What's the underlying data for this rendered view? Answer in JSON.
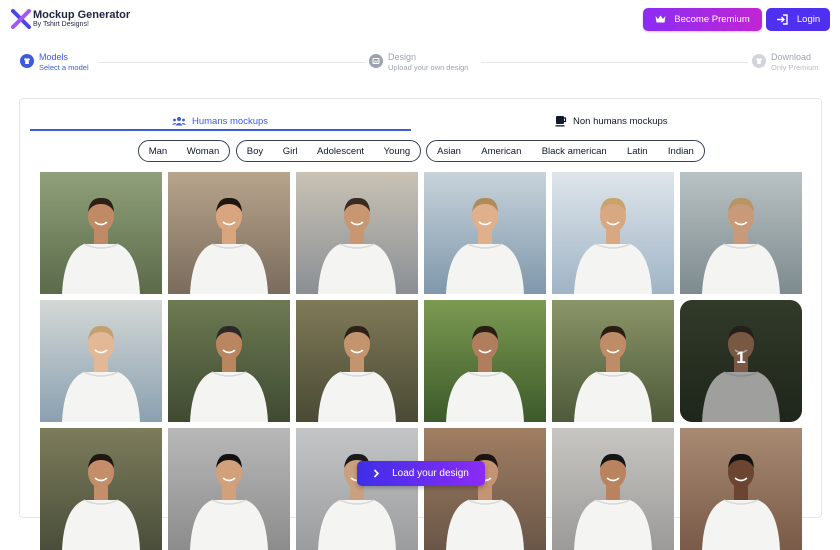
{
  "header": {
    "brand_title": "Mockup Generator",
    "brand_subtitle": "By Tshirt Designs!",
    "premium_label": "Become Premium",
    "login_label": "Login"
  },
  "steps": [
    {
      "title": "Models",
      "subtitle": "Select a model",
      "state": "active"
    },
    {
      "title": "Design",
      "subtitle": "Upload your own design",
      "state": "inactive"
    },
    {
      "title": "Download",
      "subtitle": "Only Premium",
      "state": "inactive"
    }
  ],
  "tabs": {
    "humans": "Humans mockups",
    "non_humans": "Non humans mockups"
  },
  "filters": {
    "gender": [
      "Man",
      "Woman"
    ],
    "age": [
      "Boy",
      "Girl",
      "Adolescent",
      "Young"
    ],
    "ethnicity": [
      "Asian",
      "American",
      "Black american",
      "Latin",
      "Indian"
    ]
  },
  "grid": {
    "selected_badge": "1",
    "rows": [
      [
        "boy-arms-out",
        "boy-street",
        "man-street-smiling",
        "man-rooftop-city",
        "man-balcony",
        "man-railing"
      ],
      [
        "man-city-blond",
        "man-forest-bald",
        "man-forest",
        "man-garden",
        "man-woods-beard",
        "man-woods-selected"
      ],
      [
        "man-woods-curly",
        "man-glasses-wall",
        "man-grey-wall",
        "man-street-glasses",
        "man-concrete",
        "man-brick"
      ]
    ]
  },
  "load_button": "Load your design",
  "colors": {
    "accent_blue": "#3b5bdb",
    "premium_gradient": [
      "#8b2cf5",
      "#c026d3"
    ],
    "login_bg": "#4f2ff0"
  }
}
